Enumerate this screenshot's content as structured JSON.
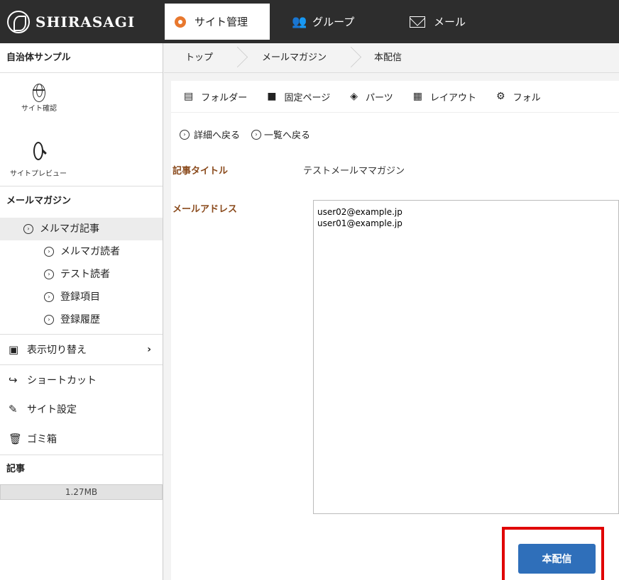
{
  "header": {
    "logo_text": "SHIRASAGI",
    "tabs": [
      {
        "label": "サイト管理",
        "icon": "gear-icon"
      },
      {
        "label": "グループ",
        "icon": "group-icon"
      },
      {
        "label": "メール",
        "icon": "mail-icon"
      }
    ]
  },
  "sidebar": {
    "site_name": "自治体サンプル",
    "tools": [
      {
        "label": "サイト確認",
        "icon": "globe-icon"
      },
      {
        "label": "サイトプレビュー",
        "icon": "search-icon"
      }
    ],
    "section_title": "メールマガジン",
    "items": [
      {
        "label": "メルマガ記事"
      },
      {
        "label": "メルマガ読者"
      },
      {
        "label": "テスト読者"
      },
      {
        "label": "登録項目"
      },
      {
        "label": "登録履歴"
      }
    ],
    "menu": [
      {
        "label": "表示切り替え",
        "icon": "display-icon"
      },
      {
        "label": "ショートカット",
        "icon": "shortcut-icon"
      },
      {
        "label": "サイト設定",
        "icon": "wrench-icon"
      },
      {
        "label": "ゴミ箱",
        "icon": "trash-icon"
      }
    ],
    "articles_title": "記事",
    "quota": "1.27MB"
  },
  "breadcrumb": [
    "トップ",
    "メールマガジン",
    "本配信"
  ],
  "navbar": [
    {
      "label": "フォルダー",
      "icon": "folder-icon"
    },
    {
      "label": "固定ページ",
      "icon": "page-icon"
    },
    {
      "label": "パーツ",
      "icon": "parts-icon"
    },
    {
      "label": "レイアウト",
      "icon": "layout-icon"
    },
    {
      "label": "フォル",
      "icon": "settings-icon"
    }
  ],
  "links": {
    "back_detail": "詳細へ戻る",
    "back_list": "一覧へ戻る"
  },
  "form": {
    "title_label": "記事タイトル",
    "title_value": "テストメールママガジン",
    "address_label": "メールアドレス",
    "addresses": "user02@example.jp\nuser01@example.jp",
    "submit_label": "本配信"
  },
  "colors": {
    "accent": "#2f6fba",
    "highlight": "#e00000",
    "label": "#8a4a1c",
    "header_bg": "#2d2d2d"
  }
}
